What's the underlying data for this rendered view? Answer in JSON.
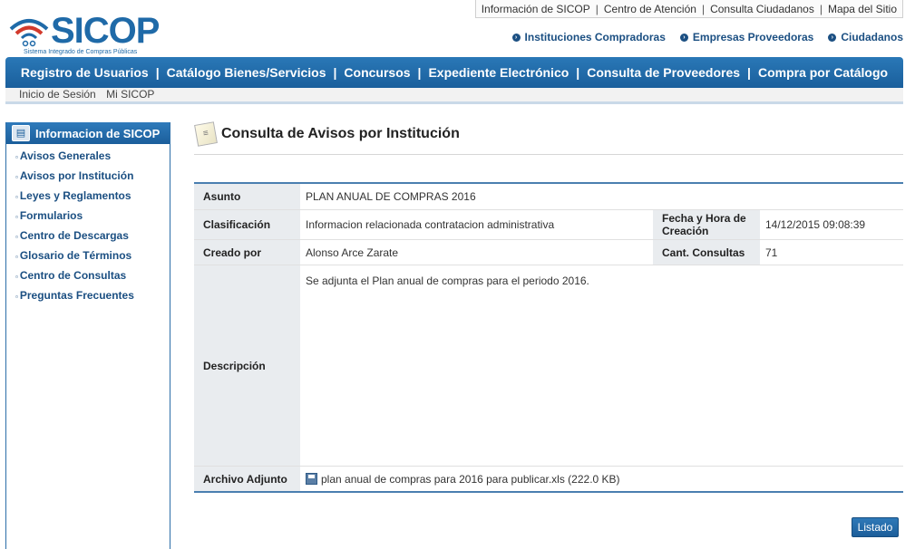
{
  "logo": {
    "title": "SICOP",
    "subtitle": "Sistema Integrado de Compras Públicas"
  },
  "top_links": [
    "Información de SICOP",
    "Centro de Atención",
    "Consulta Ciudadanos",
    "Mapa del Sitio"
  ],
  "actors": [
    "Instituciones Compradoras",
    "Empresas Proveedoras",
    "Ciudadanos"
  ],
  "main_nav": [
    "Registro de Usuarios",
    "Catálogo Bienes/Servicios",
    "Concursos",
    "Expediente Electrónico",
    "Consulta de Proveedores",
    "Compra por Catálogo"
  ],
  "sub_nav": [
    "Inicio de Sesión",
    "Mi SICOP"
  ],
  "sidebar": {
    "title": "Informacion de SICOP",
    "items": [
      "Avisos Generales",
      "Avisos por Institución",
      "Leyes y Reglamentos",
      "Formularios",
      "Centro de Descargas",
      "Glosario de Términos",
      "Centro de Consultas",
      "Preguntas Frecuentes"
    ]
  },
  "page": {
    "title": "Consulta de Avisos por Institución"
  },
  "detail": {
    "asunto_label": "Asunto",
    "asunto": "PLAN ANUAL DE COMPRAS 2016",
    "clasificacion_label": "Clasificación",
    "clasificacion": "Informacion relacionada contratacion administrativa",
    "fecha_label": "Fecha y Hora de Creación",
    "fecha": "14/12/2015 09:08:39",
    "creado_label": "Creado por",
    "creado": "Alonso Arce Zarate",
    "consultas_label": "Cant. Consultas",
    "consultas": "71",
    "descripcion_label": "Descripción",
    "descripcion": "Se adjunta el Plan anual de compras para el periodo 2016.",
    "archivo_label": "Archivo Adjunto",
    "archivo": "plan anual de compras para 2016 para publicar.xls (222.0 KB)"
  },
  "buttons": {
    "listado": "Listado"
  },
  "colors": {
    "brand_blue": "#1f6aa8",
    "nav_blue": "#1a5f9c",
    "link_blue": "#1b4f82",
    "label_bg": "#e9ecef"
  }
}
